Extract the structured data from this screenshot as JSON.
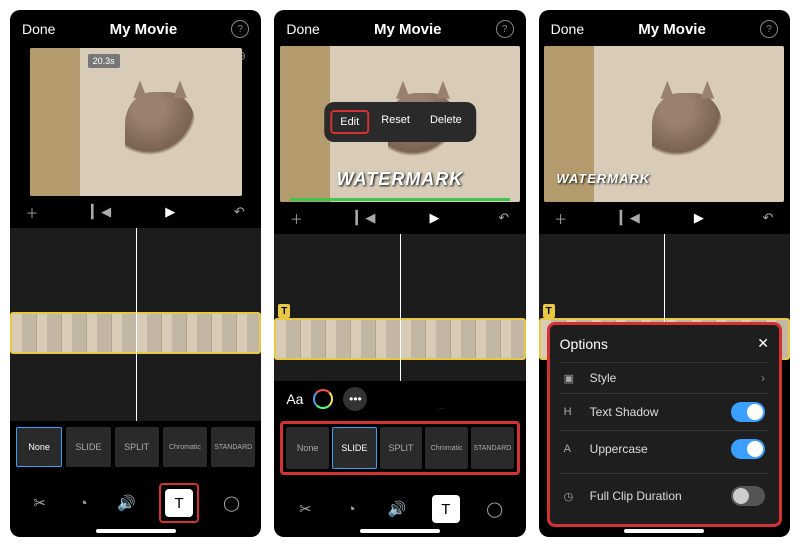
{
  "header": {
    "done": "Done",
    "title": "My Movie"
  },
  "clip": {
    "duration_badge": "20.3s"
  },
  "popup": {
    "edit": "Edit",
    "reset": "Reset",
    "delete": "Delete"
  },
  "watermark": "WATERMARK",
  "styles_pre": {
    "aa": "Aa"
  },
  "styles": [
    {
      "label": "None",
      "active_p1": true,
      "active_p2": false
    },
    {
      "label": "SLIDE",
      "active_p1": false,
      "active_p2": true
    },
    {
      "label": "SPLIT",
      "active_p1": false,
      "active_p2": false
    },
    {
      "label": "Chromatic",
      "active_p1": false,
      "active_p2": false
    },
    {
      "label": "STANDARD",
      "active_p1": false,
      "active_p2": false
    }
  ],
  "options": {
    "title": "Options",
    "rows": [
      {
        "icon": "A",
        "label": "Style",
        "kind": "nav"
      },
      {
        "icon": "H",
        "label": "Text Shadow",
        "kind": "toggle",
        "on": true
      },
      {
        "icon": "A",
        "label": "Uppercase",
        "kind": "toggle",
        "on": true
      },
      {
        "icon": "◷",
        "label": "Full Clip Duration",
        "kind": "toggle",
        "on": false
      }
    ]
  }
}
